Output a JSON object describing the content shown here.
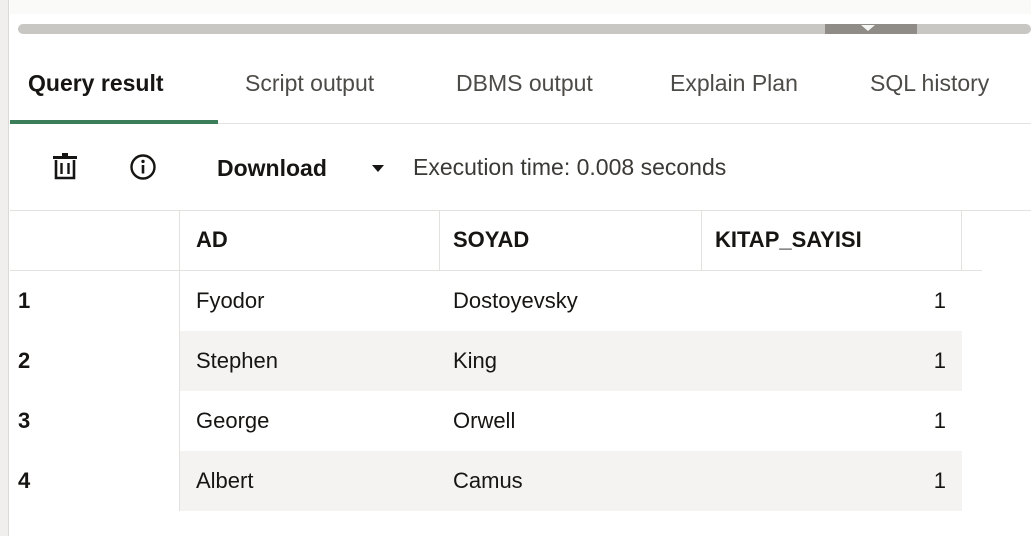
{
  "tabs": [
    {
      "label": "Query result",
      "active": true
    },
    {
      "label": "Script output",
      "active": false
    },
    {
      "label": "DBMS output",
      "active": false
    },
    {
      "label": "Explain Plan",
      "active": false
    },
    {
      "label": "SQL history",
      "active": false
    }
  ],
  "toolbar": {
    "icons": [
      "trash-icon",
      "info-icon"
    ],
    "download_label": "Download",
    "execution_time": "Execution time: 0.008 seconds"
  },
  "grid": {
    "columns": [
      "",
      "AD",
      "SOYAD",
      "KITAP_SAYISI"
    ],
    "rows": [
      {
        "num": "1",
        "ad": "Fyodor",
        "soyad": "Dostoyevsky",
        "kitap_sayisi": "1"
      },
      {
        "num": "2",
        "ad": "Stephen",
        "soyad": "King",
        "kitap_sayisi": "1"
      },
      {
        "num": "3",
        "ad": "George",
        "soyad": "Orwell",
        "kitap_sayisi": "1"
      },
      {
        "num": "4",
        "ad": "Albert",
        "soyad": "Camus",
        "kitap_sayisi": "1"
      }
    ]
  },
  "colors": {
    "active_tab_underline": "#3d7e5a",
    "alt_row": "#f4f3f2"
  }
}
